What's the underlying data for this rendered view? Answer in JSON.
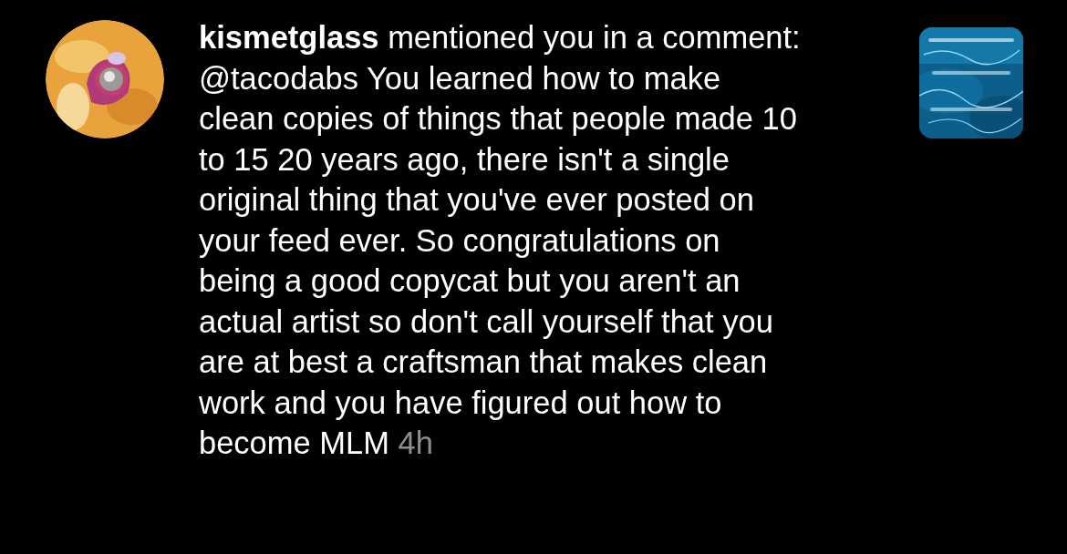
{
  "notification": {
    "message": "**kismetglass** mentioned you in a comment: @tacodabs You learned how to make clean copies of things that people made 10 to 15 20 years ago, there isn't a single original thing that you've ever posted on your feed ever. So congratulations on being a good copycat but you aren't an actual artist so don't call yourself that you are at best a craftsman that makes clean work and you have figured out how to become MLM",
    "time": "4h"
  }
}
